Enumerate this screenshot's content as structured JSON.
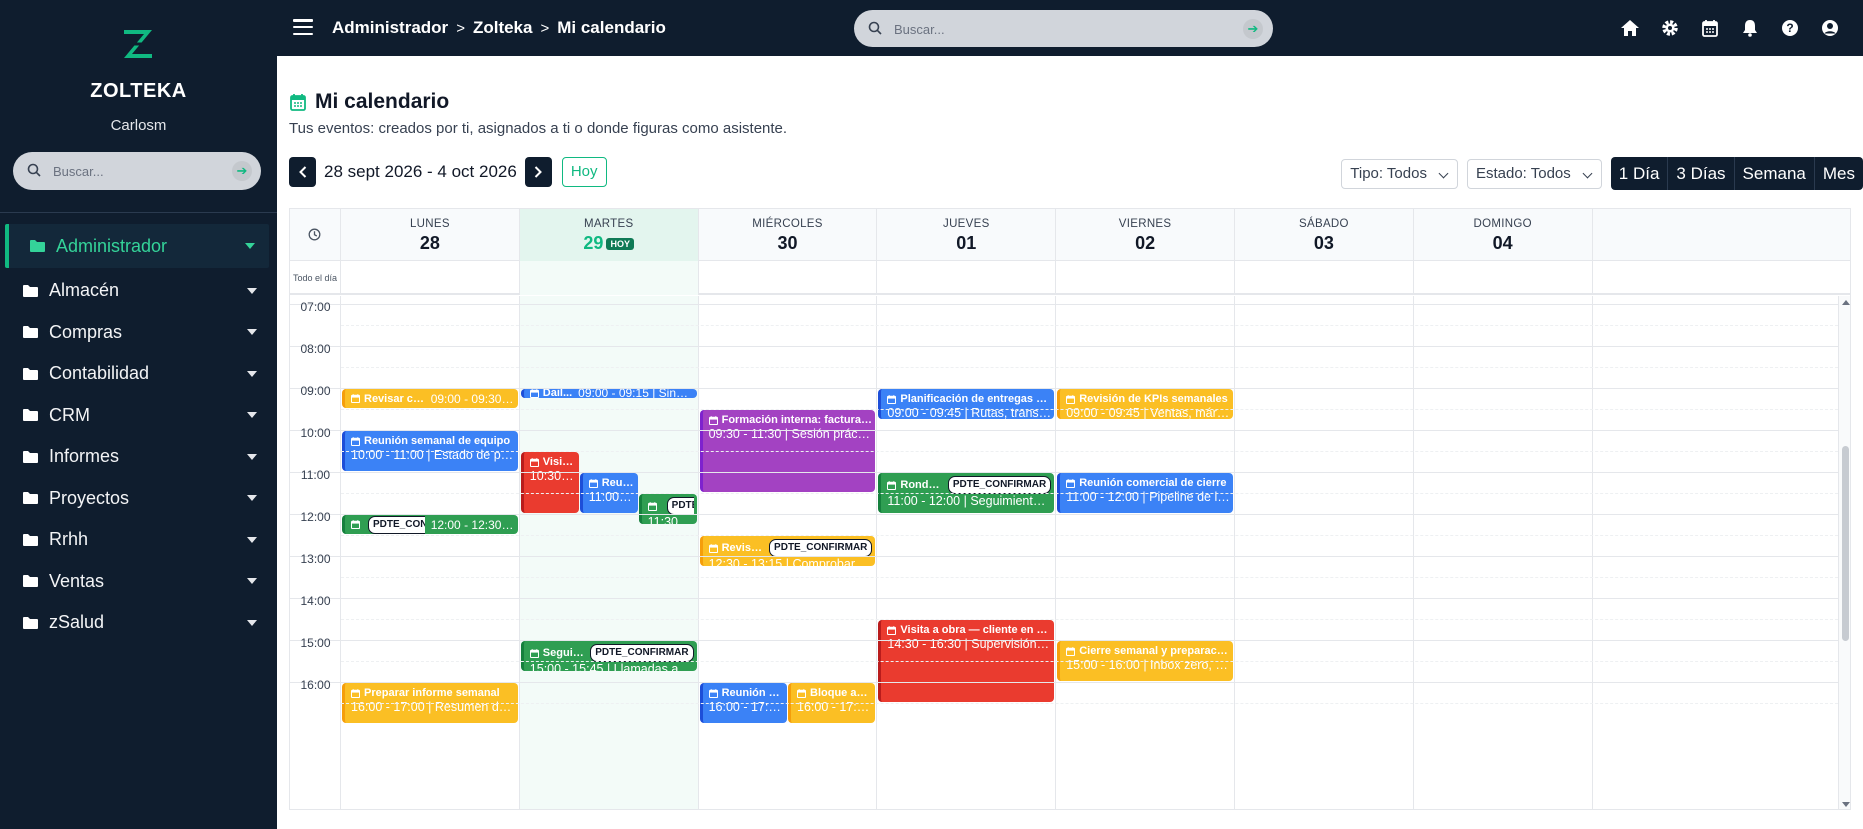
{
  "sidebar": {
    "brand": "ZOLTEKA",
    "user": "Carlosm",
    "search_placeholder": "Buscar...",
    "items": [
      {
        "label": "Administrador",
        "active": true
      },
      {
        "label": "Almacén"
      },
      {
        "label": "Compras"
      },
      {
        "label": "Contabilidad"
      },
      {
        "label": "CRM"
      },
      {
        "label": "Informes"
      },
      {
        "label": "Proyectos"
      },
      {
        "label": "Rrhh"
      },
      {
        "label": "Ventas"
      },
      {
        "label": "zSalud"
      }
    ]
  },
  "topbar": {
    "breadcrumb": [
      "Administrador",
      "Zolteka",
      "Mi calendario"
    ],
    "search_placeholder": "Buscar...",
    "icons": [
      "home-icon",
      "gear-icon",
      "calendar-icon",
      "bell-icon",
      "help-icon",
      "user-icon"
    ]
  },
  "page": {
    "title": "Mi calendario",
    "subtitle": "Tus eventos: creados por ti, asignados a ti o donde figuras como asistente.",
    "range": "28 sept 2026 - 4 oct 2026",
    "today_label": "Hoy",
    "filter_type": "Tipo: Todos",
    "filter_state": "Estado: Todos",
    "views": [
      "1 Día",
      "3 Días",
      "Semana",
      "Mes"
    ]
  },
  "calendar": {
    "allday_label": "Todo el día",
    "today_badge": "HOY",
    "days": [
      {
        "name": "LUNES",
        "num": "28"
      },
      {
        "name": "MARTES",
        "num": "29",
        "today": true
      },
      {
        "name": "MIÉRCOLES",
        "num": "30"
      },
      {
        "name": "JUEVES",
        "num": "01"
      },
      {
        "name": "VIERNES",
        "num": "02"
      },
      {
        "name": "SÁBADO",
        "num": "03"
      },
      {
        "name": "DOMINGO",
        "num": "04"
      }
    ],
    "hours": [
      "07:00",
      "08:00",
      "09:00",
      "10:00",
      "11:00",
      "12:00",
      "13:00",
      "14:00",
      "15:00",
      "16:00"
    ],
    "events": [
      {
        "day": 0,
        "start": 9.0,
        "end": 9.5,
        "lane": 0,
        "lanes": 1,
        "color": "yellow",
        "title": "Revisar cor...",
        "time": "09:00 - 09:30 | Ban...",
        "single": true
      },
      {
        "day": 0,
        "start": 10.0,
        "end": 11.0,
        "lane": 0,
        "lanes": 1,
        "color": "blue",
        "title": "Reunión semanal de equipo",
        "time": "10:00 - 11:00 | Estado de pedidos..."
      },
      {
        "day": 0,
        "start": 12.0,
        "end": 12.5,
        "lane": 0,
        "lanes": 1,
        "color": "green",
        "title": "",
        "badge": "PDTE_CONFIRM",
        "time": "12:00 - 12:30 | Co...",
        "single": true
      },
      {
        "day": 0,
        "start": 16.0,
        "end": 17.0,
        "lane": 0,
        "lanes": 1,
        "color": "yellow",
        "title": "Preparar informe semanal",
        "time": "16:00 - 17:00 | Resumen de venta..."
      },
      {
        "day": 1,
        "start": 9.0,
        "end": 9.25,
        "lane": 0,
        "lanes": 1,
        "color": "blue",
        "title": "Dail...",
        "time": "09:00 - 09:15 | Sincronizaci...",
        "single": true
      },
      {
        "day": 1,
        "start": 10.5,
        "end": 12.0,
        "lane": 0,
        "lanes": 3,
        "color": "red",
        "title": "Visita c...",
        "time": "10:30 - 1..."
      },
      {
        "day": 1,
        "start": 11.0,
        "end": 12.0,
        "lane": 1,
        "lanes": 3,
        "color": "blue",
        "title": "Reunió...",
        "time": "11:00 - 1..."
      },
      {
        "day": 1,
        "start": 11.5,
        "end": 12.25,
        "lane": 2,
        "lanes": 3,
        "color": "green",
        "title": "",
        "badge": "PDTE_CO",
        "time": "11:30 - 12..."
      },
      {
        "day": 1,
        "start": 15.0,
        "end": 15.75,
        "lane": 0,
        "lanes": 1,
        "color": "green",
        "title": "Seguimiento ...",
        "badge": "PDTE_CONFIRMAR",
        "time": "15:00 - 15:45 | Llamadas a cliente..."
      },
      {
        "day": 2,
        "start": 9.5,
        "end": 11.5,
        "lane": 0,
        "lanes": 1,
        "color": "purple",
        "title": "Formación interna: facturación ele...",
        "time": "09:30 - 11:30 | Sesión práctica Ver..."
      },
      {
        "day": 2,
        "start": 12.5,
        "end": 13.25,
        "lane": 0,
        "lanes": 1,
        "color": "yellow",
        "title": "Revisión de s...",
        "badge": "PDTE_CONFIRMAR",
        "time": "12:30 - 13:15 | Comprobar mínimo..."
      },
      {
        "day": 2,
        "start": 16.0,
        "end": 17.0,
        "lane": 0,
        "lanes": 2,
        "color": "blue",
        "title": "Reunión con d...",
        "time": "16:00 - 17:00 | ..."
      },
      {
        "day": 2,
        "start": 16.0,
        "end": 17.0,
        "lane": 1,
        "lanes": 2,
        "color": "yellow",
        "title": "Bloque admin...",
        "time": "16:00 - 17:00 | ..."
      },
      {
        "day": 3,
        "start": 9.0,
        "end": 9.75,
        "lane": 0,
        "lanes": 1,
        "color": "blue",
        "title": "Planificación de entregas de la sem...",
        "time": "09:00 - 09:45 | Rutas, transportis..."
      },
      {
        "day": 3,
        "start": 11.0,
        "end": 12.0,
        "lane": 0,
        "lanes": 1,
        "color": "green",
        "title": "Ronda de lla...",
        "badge": "PDTE_CONFIRMAR",
        "time": "11:00 - 12:00 | Seguimiento de fac..."
      },
      {
        "day": 3,
        "start": 14.5,
        "end": 16.5,
        "lane": 0,
        "lanes": 1,
        "color": "red",
        "title": "Visita a obra — cliente en curso",
        "time": "14:30 - 16:30 | Supervisión de inst..."
      },
      {
        "day": 4,
        "start": 9.0,
        "end": 9.75,
        "lane": 0,
        "lanes": 1,
        "color": "yellow",
        "title": "Revisión de KPIs semanales",
        "time": "09:00 - 09:45 | Ventas, márgenes..."
      },
      {
        "day": 4,
        "start": 11.0,
        "end": 12.0,
        "lane": 0,
        "lanes": 1,
        "color": "blue",
        "title": "Reunión comercial de cierre",
        "time": "11:00 - 12:00 | Pipeline de la próxi..."
      },
      {
        "day": 4,
        "start": 15.0,
        "end": 16.0,
        "lane": 0,
        "lanes": 1,
        "color": "yellow",
        "title": "Cierre semanal y preparación del lu...",
        "time": "15:00 - 16:00 | Inbox zero, tareas ..."
      }
    ]
  },
  "colors": {
    "accent": "#10b981",
    "navy": "#0f1d2e",
    "yellow": "#fbbf24",
    "blue": "#3b82f6",
    "green": "#2f9e52",
    "purple": "#a342c2",
    "red": "#ea3b2f"
  }
}
